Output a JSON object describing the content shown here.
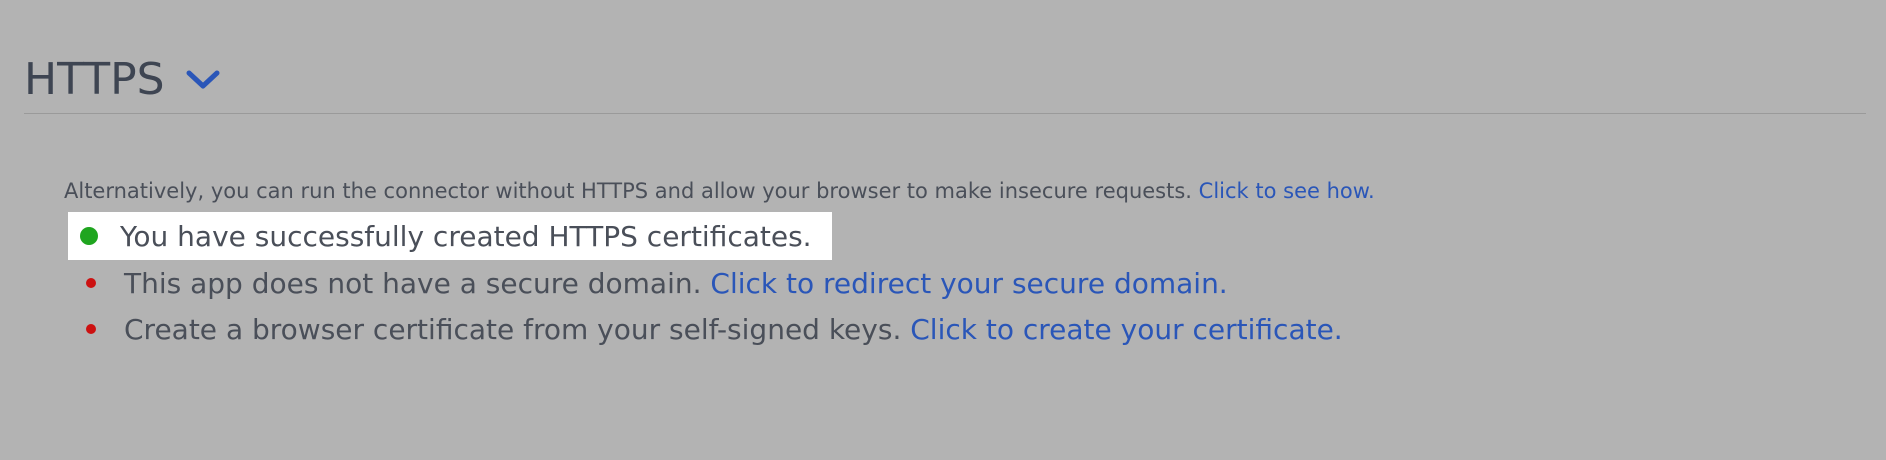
{
  "section": {
    "title": "HTTPS",
    "toggle_icon": "chevron-down-icon"
  },
  "intro": {
    "text": "Alternatively, you can run the connector without HTTPS and allow your browser to make insecure requests.",
    "link_text": "Click to see how."
  },
  "status_items": [
    {
      "status": "success",
      "text": "You have successfully created HTTPS certificates.",
      "link_text": ""
    },
    {
      "status": "error",
      "text": "This app does not have a secure domain.",
      "link_text": "Click to redirect your secure domain."
    },
    {
      "status": "error",
      "text": "Create a browser certificate from your self-signed keys.",
      "link_text": "Click to create your certificate."
    }
  ],
  "colors": {
    "background": "#b3b3b3",
    "link": "#2a56b8",
    "success_dot": "#1fa51f",
    "error_dot": "#cc1111",
    "text": "#4a4f59"
  }
}
